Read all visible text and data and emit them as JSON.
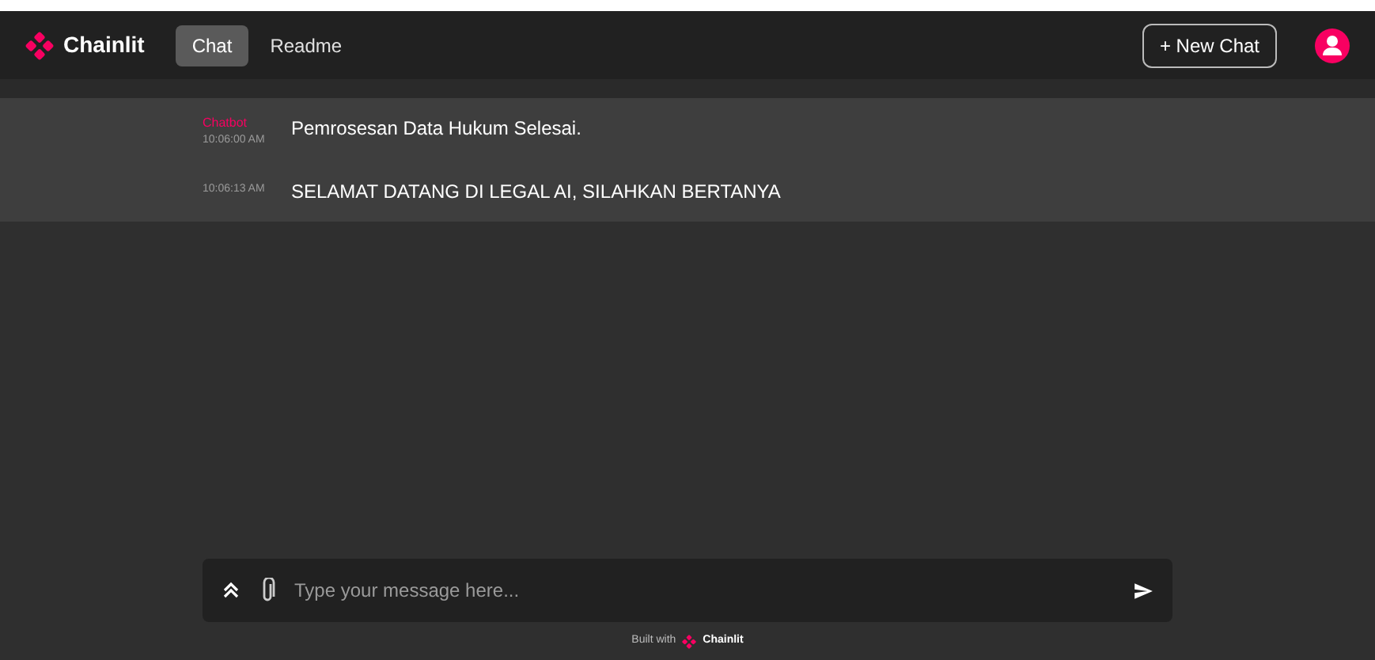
{
  "header": {
    "logo": "Chainlit",
    "tabs": [
      {
        "label": "Chat",
        "selected": true
      },
      {
        "label": "Readme",
        "selected": false
      }
    ],
    "new_chat": "+ New Chat"
  },
  "messages": [
    {
      "author": "Chatbot",
      "time": "10:06:00 AM",
      "text": "Pemrosesan Data Hukum Selesai."
    },
    {
      "time": "10:06:13 AM",
      "text": "SELAMAT DATANG DI LEGAL AI, SILAHKAN BERTANYA"
    }
  ],
  "composer": {
    "placeholder": "Type your message here..."
  },
  "footer": {
    "built_with": "Built with",
    "brand": "Chainlit"
  }
}
